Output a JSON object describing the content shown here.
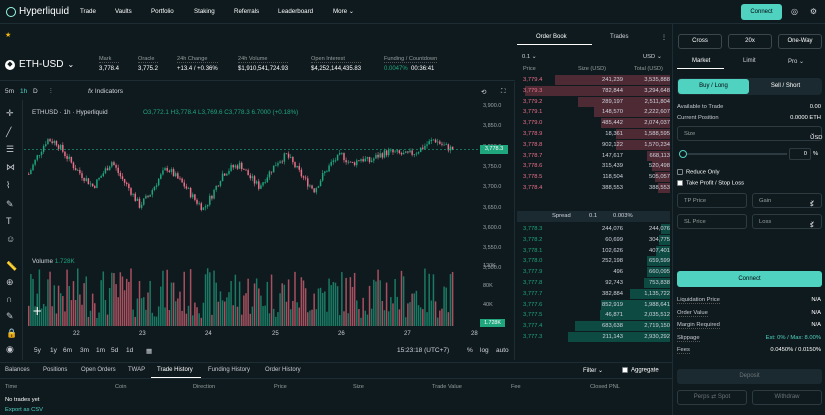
{
  "topnav": {
    "logo": "Hyperliquid",
    "items": [
      "Trade",
      "Vaults",
      "Portfolio",
      "Staking",
      "Referrals",
      "Leaderboard",
      "More"
    ],
    "connect": "Connect",
    "icons": [
      "globe-icon",
      "gear-icon"
    ]
  },
  "pair": {
    "symbol": "ETH-USD",
    "stats": [
      {
        "label": "Mark",
        "value": "3,778.4"
      },
      {
        "label": "Oracle",
        "value": "3,775.2"
      },
      {
        "label": "24h Change",
        "value": "+13.4 / +0.36%"
      },
      {
        "label": "24h Volume",
        "value": "$1,910,541,724.93"
      },
      {
        "label": "Open Interest",
        "value": "$4,252,144,435.83"
      },
      {
        "label": "Funding / Countdown",
        "value": "0.0047%",
        "value2": "00:36:41"
      }
    ]
  },
  "chart": {
    "intervals": [
      "5m",
      "1h",
      "D"
    ],
    "indicators": "Indicators",
    "title": "ETHUSD · 1h · Hyperliquid",
    "ohlc": "O3,772.1 H3,778.4 L3,769.6 C3,778.3 6.7000 (+0.18%)",
    "price_labels": [
      "3,900.0",
      "3,850.0",
      "3,800.0",
      "3,750.0",
      "3,700.0",
      "3,650.0",
      "3,600.0",
      "3,550.0",
      "3,500.0"
    ],
    "current_price": "3,778.3",
    "volume_label": "Volume",
    "volume_value": "1.728K",
    "volume_axis": [
      "120K",
      "80K",
      "40K"
    ],
    "volume_current": "1.728K",
    "dates": [
      "22",
      "23",
      "24",
      "25",
      "26",
      "27",
      "28"
    ],
    "timeframes": [
      "5y",
      "1y",
      "6m",
      "3m",
      "1m",
      "5d",
      "1d"
    ],
    "clock": "15:23:18 (UTC+7)",
    "scale_opts": [
      "%",
      "log",
      "auto"
    ]
  },
  "chart_data": {
    "type": "candlestick",
    "title": "ETHUSD · 1h · Hyperliquid",
    "ylim": [
      3450,
      3925
    ],
    "x": [
      "22",
      "23",
      "24",
      "25",
      "26",
      "27",
      "28"
    ],
    "close_path": [
      3700,
      3760,
      3810,
      3800,
      3760,
      3720,
      3690,
      3660,
      3700,
      3740,
      3690,
      3650,
      3600,
      3630,
      3680,
      3720,
      3690,
      3660,
      3620,
      3590,
      3640,
      3700,
      3720,
      3730,
      3690,
      3660,
      3700,
      3740,
      3760,
      3720,
      3680,
      3650,
      3700,
      3740,
      3760,
      3730,
      3750,
      3740,
      3760,
      3770,
      3765,
      3760,
      3770,
      3790,
      3810,
      3790,
      3778.3
    ]
  },
  "orderbook": {
    "tabs": [
      "Order Book",
      "Trades"
    ],
    "tick": "0.1",
    "unit": "USD",
    "headers": [
      "Price",
      "Size (USD)",
      "Total (USD)"
    ],
    "asks": [
      [
        "3,779.4",
        "241,239",
        "3,535,888",
        0.75
      ],
      [
        "3,779.3",
        "782,844",
        "3,294,648",
        0.95
      ],
      [
        "3,779.2",
        "289,197",
        "2,511,804",
        0.6
      ],
      [
        "3,779.1",
        "148,570",
        "2,222,607",
        0.5
      ],
      [
        "3,779.0",
        "485,442",
        "2,074,037",
        0.45
      ],
      [
        "3,778.9",
        "18,361",
        "1,588,595",
        0.35
      ],
      [
        "3,778.8",
        "902,122",
        "1,570,234",
        0.35
      ],
      [
        "3,778.7",
        "147,617",
        "668,113",
        0.15
      ],
      [
        "3,778.6",
        "315,439",
        "520,498",
        0.12
      ],
      [
        "3,778.5",
        "118,504",
        "505,057",
        0.1
      ],
      [
        "3,778.4",
        "388,553",
        "388,553",
        0.08
      ]
    ],
    "spread": {
      "label": "Spread",
      "value": "0.1",
      "pct": "0.003%"
    },
    "bids": [
      [
        "3,778.3",
        "244,076",
        "244,076",
        0.06
      ],
      [
        "3,778.2",
        "60,699",
        "304,775",
        0.07
      ],
      [
        "3,778.1",
        "102,626",
        "407,401",
        0.09
      ],
      [
        "3,778.0",
        "252,198",
        "659,599",
        0.15
      ],
      [
        "3,777.9",
        "496",
        "660,095",
        0.15
      ],
      [
        "3,777.8",
        "92,743",
        "753,838",
        0.17
      ],
      [
        "3,777.7",
        "382,884",
        "1,135,722",
        0.26
      ],
      [
        "3,777.6",
        "852,919",
        "1,988,641",
        0.45
      ],
      [
        "3,777.5",
        "46,871",
        "2,035,512",
        0.46
      ],
      [
        "3,777.4",
        "683,638",
        "2,719,150",
        0.62
      ],
      [
        "3,777.3",
        "211,143",
        "2,930,292",
        0.67
      ]
    ]
  },
  "panel": {
    "margin_mode": "Cross",
    "leverage": "20x",
    "position_mode": "One-Way",
    "order_tabs": [
      "Market",
      "Limit",
      "Pro"
    ],
    "sides": [
      "Buy / Long",
      "Sell / Short"
    ],
    "available_label": "Available to Trade",
    "available_value": "0.00",
    "current_pos_label": "Current Position",
    "current_pos_value": "0.0000 ETH",
    "size_label": "Size",
    "size_unit": "USD",
    "slider_value": "0",
    "slider_unit": "%",
    "reduce_only": "Reduce Only",
    "tpsl": "Take Profit / Stop Loss",
    "tp_price": "TP Price",
    "tp_gain": "Gain",
    "sl_price": "SL Price",
    "sl_loss": "Loss",
    "dollar": "$",
    "connect": "Connect",
    "info": [
      {
        "label": "Liquidation Price",
        "value": "N/A"
      },
      {
        "label": "Order Value",
        "value": "N/A"
      },
      {
        "label": "Margin Required",
        "value": "N/A"
      },
      {
        "label": "Slippage",
        "value": "Est: 0% / Max: 8.00%"
      },
      {
        "label": "Fees",
        "value": "0.0450% / 0.0150%"
      }
    ],
    "deposit": "Deposit",
    "perps_spot": "Perps ⇄ Spot",
    "withdraw": "Withdraw"
  },
  "bottom": {
    "tabs": [
      "Balances",
      "Positions",
      "Open Orders",
      "TWAP",
      "Trade History",
      "Funding History",
      "Order History"
    ],
    "filter": "Filter",
    "aggregate": "Aggregate",
    "columns": [
      "Time",
      "Coin",
      "Direction",
      "Price",
      "Size",
      "Trade Value",
      "Fee",
      "Closed PNL"
    ],
    "empty": "No trades yet",
    "export": "Export as CSV"
  }
}
